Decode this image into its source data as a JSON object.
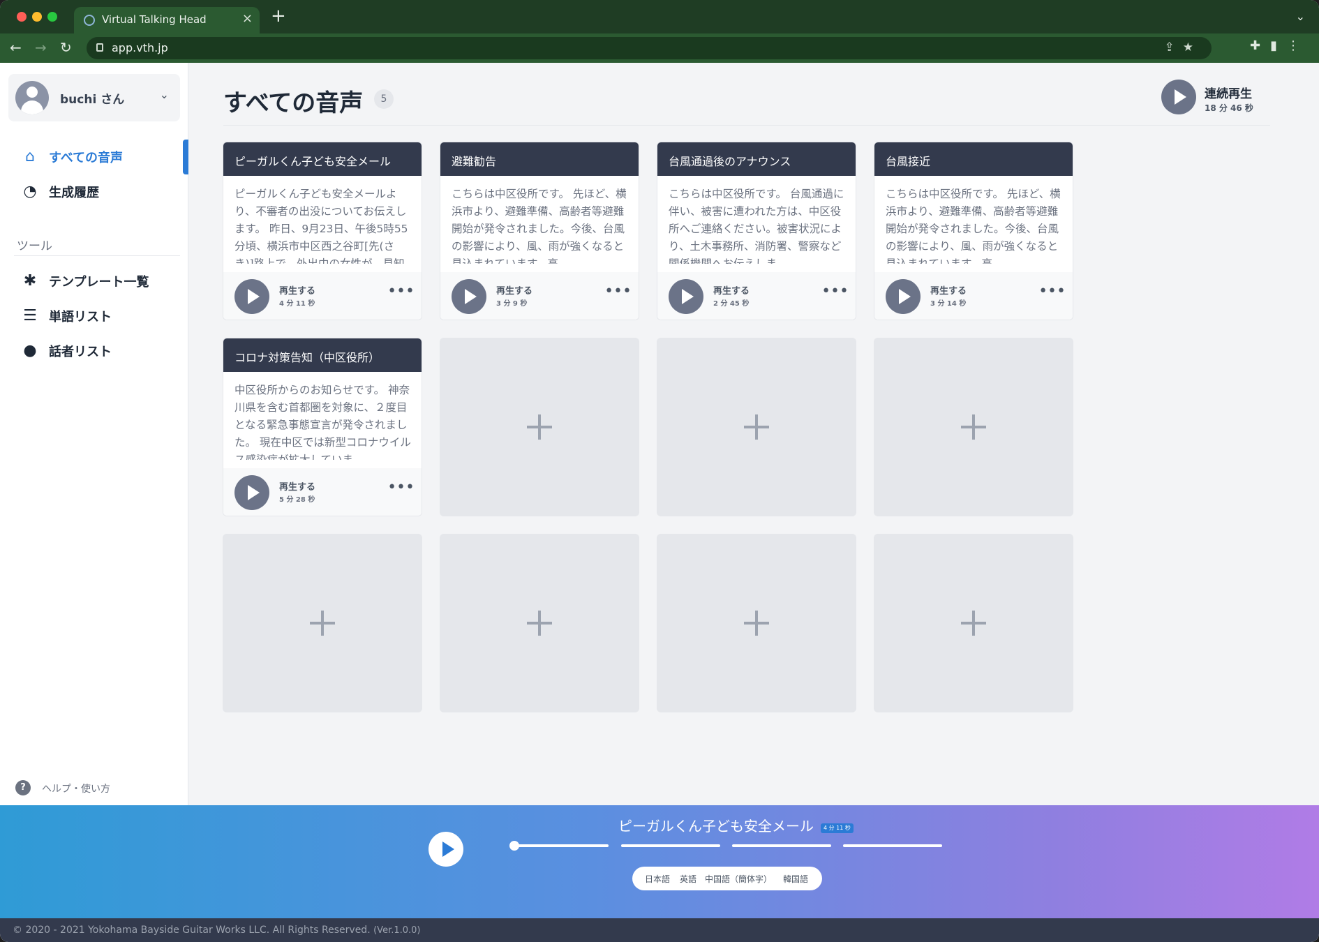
{
  "browser": {
    "tab_title": "Virtual Talking Head",
    "url": "app.vth.jp"
  },
  "sidebar": {
    "user_name": "buchi さん",
    "nav": [
      {
        "label": "すべての音声",
        "icon": "home-icon",
        "active": true
      },
      {
        "label": "生成履歴",
        "icon": "history-icon",
        "active": false
      }
    ],
    "tools_section": "ツール",
    "tools": [
      {
        "label": "テンプレート一覧",
        "icon": "puzzle-icon"
      },
      {
        "label": "単語リスト",
        "icon": "list-icon"
      },
      {
        "label": "話者リスト",
        "icon": "speaker-icon"
      }
    ],
    "help_label": "ヘルプ・使い方"
  },
  "main": {
    "title": "すべての音声",
    "count": "5",
    "continuous_play": {
      "label": "連続再生",
      "time": "18 分 46 秒"
    },
    "cards": [
      {
        "title": "ピーガルくん子ども安全メール",
        "body": "ピーガルくん子ども安全メールより、不審者の出没についてお伝えします。 昨日、9月23日、午後5時55分頃、横浜市中区西之谷町[先(さき)]路上で、外出中の女性が、見知",
        "play_label": "再生する",
        "duration": "4 分 11 秒"
      },
      {
        "title": "避難勧告",
        "body": "こちらは中区役所です。 先ほど、横浜市より、避難準備、高齢者等避難開始が発令されました。今後、台風の影響により、風、雨が強くなると見込まれています。高",
        "play_label": "再生する",
        "duration": "3 分 9 秒"
      },
      {
        "title": "台風通過後のアナウンス",
        "body": "こちらは中区役所です。 台風通過に伴い、被害に遭われた方は、中区役所へご連絡ください。被害状況により、土木事務所、消防署、警察など関係機関へお伝えしま",
        "play_label": "再生する",
        "duration": "2 分 45 秒"
      },
      {
        "title": "台風接近",
        "body": "こちらは中区役所です。 先ほど、横浜市より、避難準備、高齢者等避難開始が発令されました。今後、台風の影響により、風、雨が強くなると見込まれています。高",
        "play_label": "再生する",
        "duration": "3 分 14 秒"
      },
      {
        "title": "コロナ対策告知（中区役所）",
        "body": "中区役所からのお知らせです。 神奈川県を含む首都圏を対象に、２度目となる緊急事態宣言が発令されました。 現在中区では新型コロナウイルス感染症が拡大していま",
        "play_label": "再生する",
        "duration": "5 分 28 秒"
      }
    ]
  },
  "player": {
    "title": "ピーガルくん子ども安全メール",
    "duration_badge": "4 分 11 秒",
    "languages": [
      "日本語",
      "英語",
      "中国語（簡体字）",
      "韓国語"
    ]
  },
  "footer": {
    "copyright": "© 2020 - 2021 Yokohama Bayside Guitar Works LLC. All Rights Reserved.",
    "version": "(Ver.1.0.0)"
  }
}
